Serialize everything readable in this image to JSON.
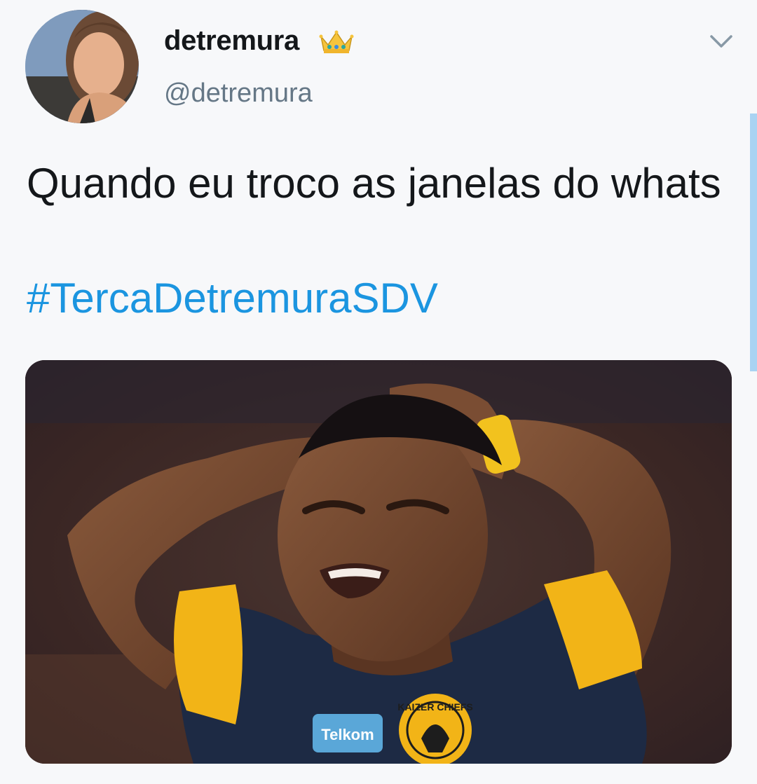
{
  "tweet": {
    "author": {
      "display_name": "detremura",
      "handle": "@detremura",
      "badge_icon": "crown-icon"
    },
    "menu_icon": "chevron-down-icon",
    "text": "Quando eu troco as janelas do whats",
    "hashtag": "#TercaDetremuraSDV",
    "media": {
      "jersey_sponsor": "Telkom",
      "badge_text": "KAIZER CHIEFS"
    }
  },
  "colors": {
    "background": "#f7f8fa",
    "text_primary": "#14171a",
    "text_secondary": "#657786",
    "link": "#1b95e0",
    "scroll_indicator": "#a9d3f2",
    "jersey_navy": "#1d2a44",
    "jersey_gold": "#f2b417"
  }
}
